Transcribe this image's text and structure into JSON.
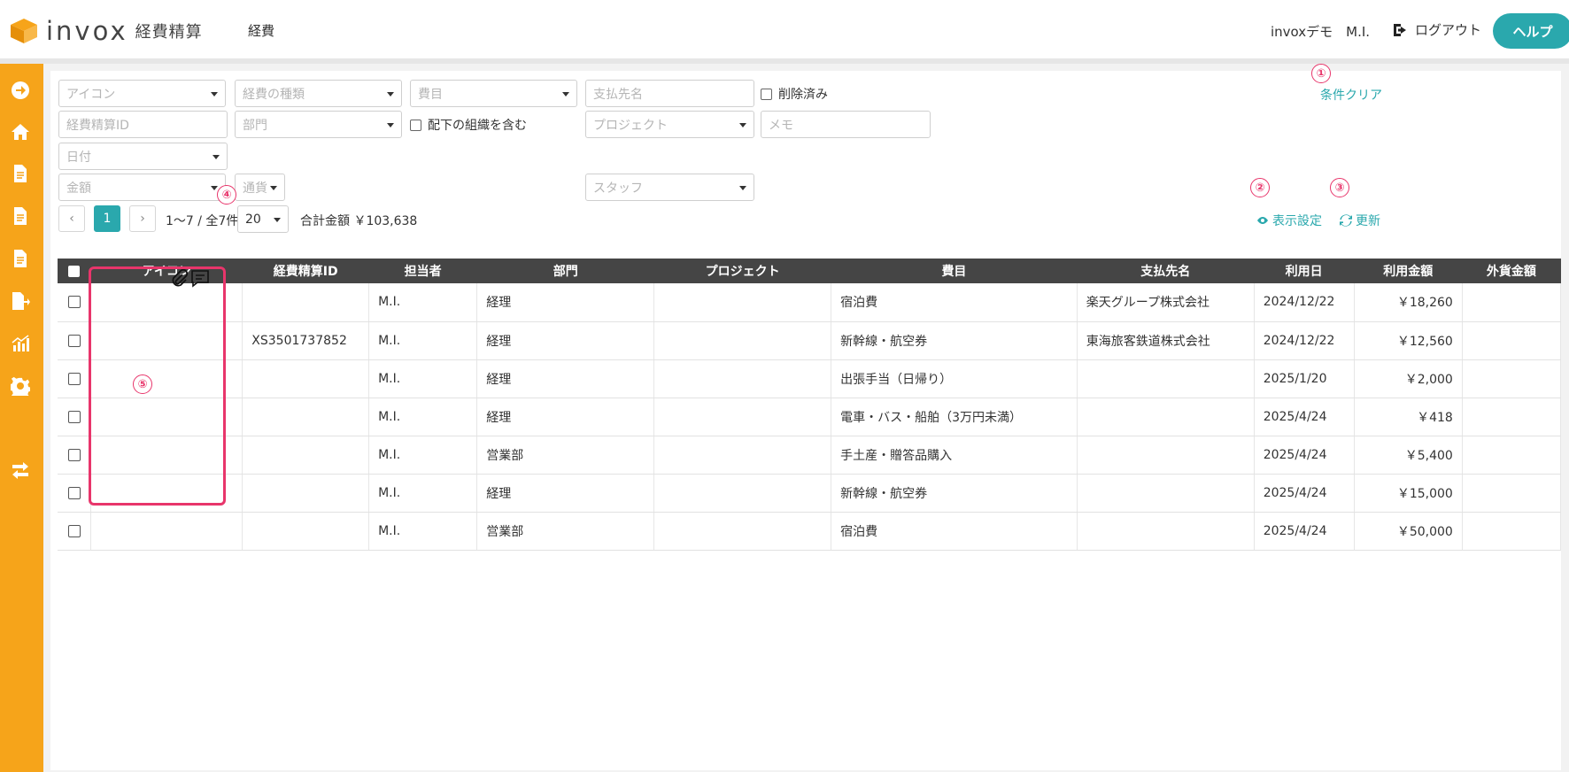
{
  "header": {
    "logo_text": "invox",
    "logo_sub": "経費精算",
    "nav_label": "経費",
    "user_label": "invoxデモ　M.I.",
    "logout_label": "ログアウト",
    "help_label": "ヘルプ"
  },
  "sidebar": {
    "items": [
      "arrow-right-circle-icon",
      "home-icon",
      "document-icon",
      "document-icon",
      "document-icon",
      "document-export-icon",
      "chart-icon",
      "gear-icon",
      "transfer-icon"
    ]
  },
  "filters": {
    "icon_placeholder": "アイコン",
    "expense_type_placeholder": "経費の種類",
    "expense_item_placeholder": "費目",
    "payee_placeholder": "支払先名",
    "deleted_label": "削除済み",
    "clear_label": "条件クリア",
    "expense_id_placeholder": "経費精算ID",
    "department_placeholder": "部門",
    "include_sub_label": "配下の組織を含む",
    "project_placeholder": "プロジェクト",
    "memo_placeholder": "メモ",
    "date_placeholder": "日付",
    "amount_placeholder": "金額",
    "currency_placeholder": "通貨",
    "staff_placeholder": "スタッフ"
  },
  "pager": {
    "prev": "‹",
    "page": "1",
    "next": "›",
    "range": "1〜7 / 全7件",
    "per_page": "20",
    "total_label": "合計金額 ￥103,638",
    "display_settings": "表示設定",
    "refresh": "更新"
  },
  "markers": {
    "m1": "①",
    "m2": "②",
    "m3": "③",
    "m4": "④",
    "m5": "⑤"
  },
  "table": {
    "columns": [
      "アイコン",
      "経費精算ID",
      "担当者",
      "部門",
      "プロジェクト",
      "費目",
      "支払先名",
      "利用日",
      "利用金額",
      "外貨金額"
    ],
    "rows": [
      {
        "id": "",
        "staff": "M.I.",
        "dept": "経理",
        "project": "",
        "item": "宿泊費",
        "payee": "楽天グループ株式会社",
        "date": "2024/12/22",
        "amount": "￥18,260",
        "foreign": ""
      },
      {
        "id": "XS3501737852",
        "staff": "M.I.",
        "dept": "経理",
        "project": "",
        "item": "新幹線・航空券",
        "payee": "東海旅客鉄道株式会社",
        "date": "2024/12/22",
        "amount": "￥12,560",
        "foreign": ""
      },
      {
        "id": "",
        "staff": "M.I.",
        "dept": "経理",
        "project": "",
        "item": "出張手当（日帰り）",
        "payee": "",
        "date": "2025/1/20",
        "amount": "￥2,000",
        "foreign": ""
      },
      {
        "id": "",
        "staff": "M.I.",
        "dept": "経理",
        "project": "",
        "item": "電車・バス・船舶（3万円未満）",
        "payee": "",
        "date": "2025/4/24",
        "amount": "￥418",
        "foreign": ""
      },
      {
        "id": "",
        "staff": "M.I.",
        "dept": "営業部",
        "project": "",
        "item": "手土産・贈答品購入",
        "payee": "",
        "date": "2025/4/24",
        "amount": "￥5,400",
        "foreign": ""
      },
      {
        "id": "",
        "staff": "M.I.",
        "dept": "経理",
        "project": "",
        "item": "新幹線・航空券",
        "payee": "",
        "date": "2025/4/24",
        "amount": "￥15,000",
        "foreign": ""
      },
      {
        "id": "",
        "staff": "M.I.",
        "dept": "営業部",
        "project": "",
        "item": "宿泊費",
        "payee": "",
        "date": "2025/4/24",
        "amount": "￥50,000",
        "foreign": ""
      }
    ]
  },
  "colors": {
    "accent": "#2aa8ad",
    "sidebar": "#f6a41a",
    "marker": "#e8356b"
  }
}
